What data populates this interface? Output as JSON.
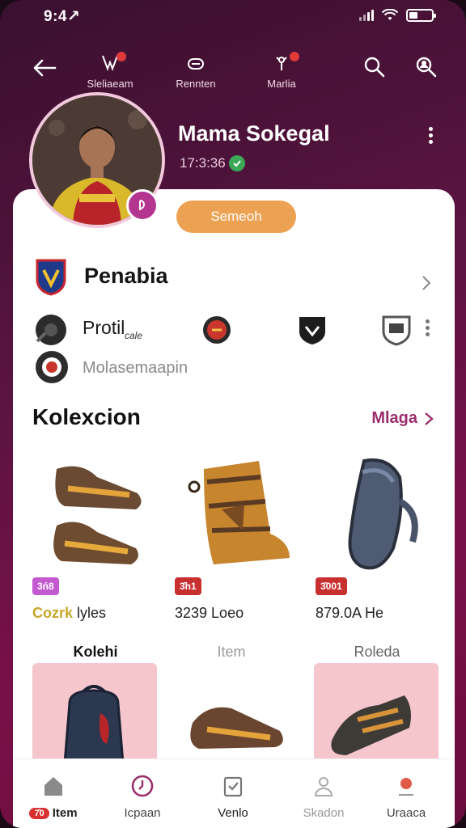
{
  "status_bar": {
    "time": "9:4↗"
  },
  "top_nav": {
    "tabs": [
      {
        "label": "Sleliaeam"
      },
      {
        "label": "Rennten"
      },
      {
        "label": "Marlia"
      }
    ]
  },
  "profile": {
    "name": "Mama Sokegal",
    "stat": "17:3:36",
    "follow_label": "Semeoh"
  },
  "team": {
    "name": "Penabia"
  },
  "profil": {
    "label": "Protil",
    "sublabel": "cale"
  },
  "mola": {
    "label": "Molasemaapin"
  },
  "collection": {
    "title": "Kolexcion",
    "more_label": "Mlaga",
    "products": [
      {
        "tag": "3ń8",
        "tag_color": "#c45ad0",
        "price_highlight": "Cozrk",
        "price": "lyles"
      },
      {
        "tag": "3̂h1",
        "tag_color": "#c83030",
        "price_highlight": "",
        "price": "3239 Loeo"
      },
      {
        "tag": "3̂001",
        "tag_color": "#c83030",
        "price_highlight": "",
        "price": "879.0A He"
      }
    ]
  },
  "subtabs": [
    {
      "label": "Kolehi"
    },
    {
      "label": "Item"
    },
    {
      "label": "Roleda"
    }
  ],
  "bottom_nav": [
    {
      "badge": "7̂0",
      "label": "Item"
    },
    {
      "label": "Icpaan"
    },
    {
      "label": "Venlo"
    },
    {
      "label": "Skadon"
    },
    {
      "label": "Uraaca"
    }
  ],
  "colors": {
    "accent": "#9a2f6c",
    "follow_button": "#eda253",
    "header_gradient": "#6a0d3c"
  }
}
